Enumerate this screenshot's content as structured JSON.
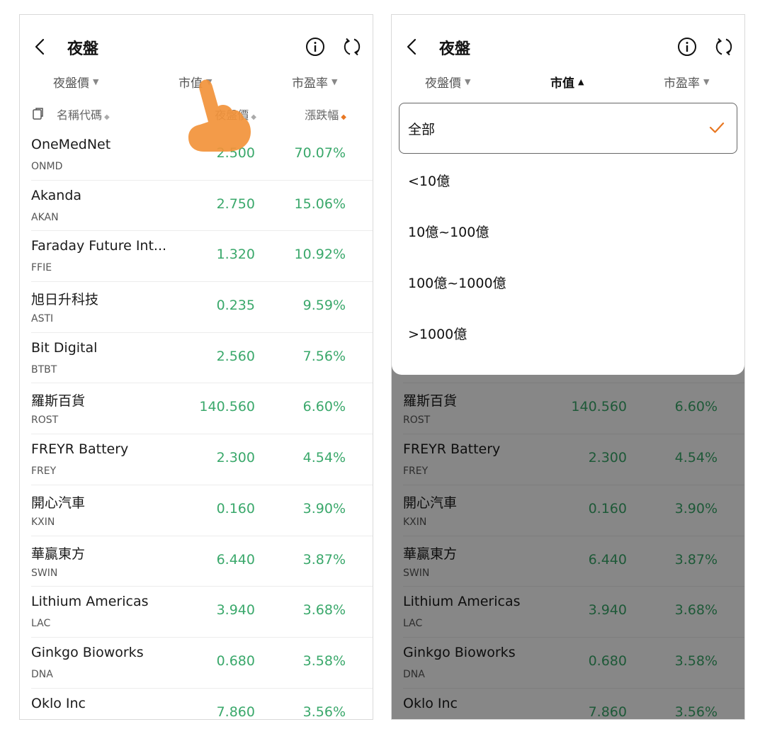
{
  "header": {
    "title": "夜盤"
  },
  "filters": [
    {
      "label": "夜盤價",
      "caret": "▼"
    },
    {
      "label": "市值",
      "caret": "▼"
    },
    {
      "label": "市盈率",
      "caret": "▼"
    }
  ],
  "filters_open": [
    {
      "label": "夜盤價",
      "caret": "▼"
    },
    {
      "label": "市值",
      "caret": "▲"
    },
    {
      "label": "市盈率",
      "caret": "▼"
    }
  ],
  "columns": {
    "name": "名稱代碼",
    "price": "夜盤價",
    "change": "漲跌幅",
    "sort_neutral": "◆",
    "sort_active": "◆"
  },
  "stocks": [
    {
      "name": "OneMedNet",
      "code": "ONMD",
      "price": "2.500",
      "change": "70.07%"
    },
    {
      "name": "Akanda",
      "code": "AKAN",
      "price": "2.750",
      "change": "15.06%"
    },
    {
      "name": "Faraday Future Int...",
      "code": "FFIE",
      "price": "1.320",
      "change": "10.92%"
    },
    {
      "name": "旭日升科技",
      "code": "ASTI",
      "price": "0.235",
      "change": "9.59%"
    },
    {
      "name": "Bit Digital",
      "code": "BTBT",
      "price": "2.560",
      "change": "7.56%"
    },
    {
      "name": "羅斯百貨",
      "code": "ROST",
      "price": "140.560",
      "change": "6.60%"
    },
    {
      "name": "FREYR Battery",
      "code": "FREY",
      "price": "2.300",
      "change": "4.54%"
    },
    {
      "name": "開心汽車",
      "code": "KXIN",
      "price": "0.160",
      "change": "3.90%"
    },
    {
      "name": "華贏東方",
      "code": "SWIN",
      "price": "6.440",
      "change": "3.87%"
    },
    {
      "name": "Lithium Americas",
      "code": "LAC",
      "price": "3.940",
      "change": "3.68%"
    },
    {
      "name": "Ginkgo Bioworks",
      "code": "DNA",
      "price": "0.680",
      "change": "3.58%"
    },
    {
      "name": "Oklo Inc",
      "code": "",
      "price": "7.860",
      "change": "3.56%"
    }
  ],
  "market_cap_options": [
    {
      "label": "全部",
      "selected": true
    },
    {
      "label": "<10億",
      "selected": false
    },
    {
      "label": "10億~100億",
      "selected": false
    },
    {
      "label": "100億~1000億",
      "selected": false
    },
    {
      "label": ">1000億",
      "selected": false
    }
  ],
  "colors": {
    "up_green": "#3aa86b",
    "accent_orange": "#e87722"
  }
}
